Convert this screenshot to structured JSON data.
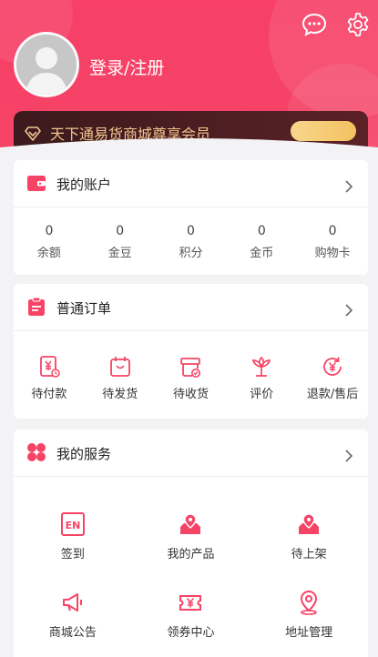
{
  "user": {
    "login_label": "登录/注册"
  },
  "vip": {
    "text": "天下通易货商城尊享会员"
  },
  "account": {
    "title": "我的账户",
    "items": [
      {
        "value": "0",
        "label": "余额"
      },
      {
        "value": "0",
        "label": "金豆"
      },
      {
        "value": "0",
        "label": "积分"
      },
      {
        "value": "0",
        "label": "金币"
      },
      {
        "value": "0",
        "label": "购物卡"
      }
    ]
  },
  "orders": {
    "title": "普通订单",
    "items": [
      {
        "label": "待付款",
        "icon": "yen-bill-icon"
      },
      {
        "label": "待发货",
        "icon": "package-icon"
      },
      {
        "label": "待收货",
        "icon": "box-check-icon"
      },
      {
        "label": "评价",
        "icon": "flower-icon"
      },
      {
        "label": "退款/售后",
        "icon": "refund-icon"
      }
    ]
  },
  "services": {
    "title": "我的服务",
    "items": [
      {
        "label": "签到",
        "icon": "en-badge-icon"
      },
      {
        "label": "我的产品",
        "icon": "location-box-icon"
      },
      {
        "label": "待上架",
        "icon": "location-box-icon"
      },
      {
        "label": "商城公告",
        "icon": "megaphone-icon"
      },
      {
        "label": "领券中心",
        "icon": "coupon-icon"
      },
      {
        "label": "地址管理",
        "icon": "location-pin-icon"
      }
    ]
  },
  "colors": {
    "accent": "#f64466",
    "vip_gold": "#f3c68f",
    "vip_bg": "#3b1a1d"
  }
}
